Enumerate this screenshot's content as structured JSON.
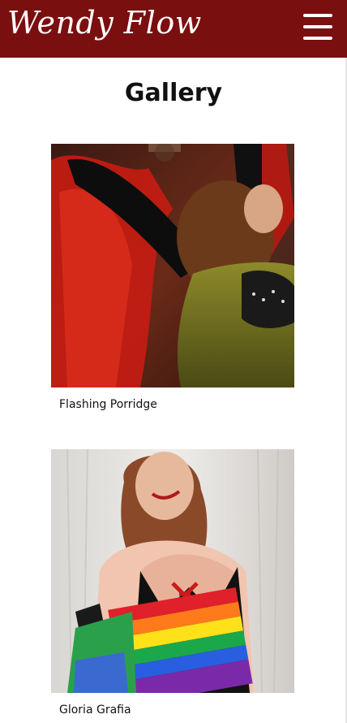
{
  "header": {
    "logo_text": "Wendy Flow",
    "menu_icon": "hamburger-menu-icon",
    "background_color": "#7a0f0f"
  },
  "main": {
    "title": "Gallery",
    "gallery": [
      {
        "caption": "Flashing Porridge"
      },
      {
        "caption": "Gloria Grafia"
      }
    ]
  }
}
